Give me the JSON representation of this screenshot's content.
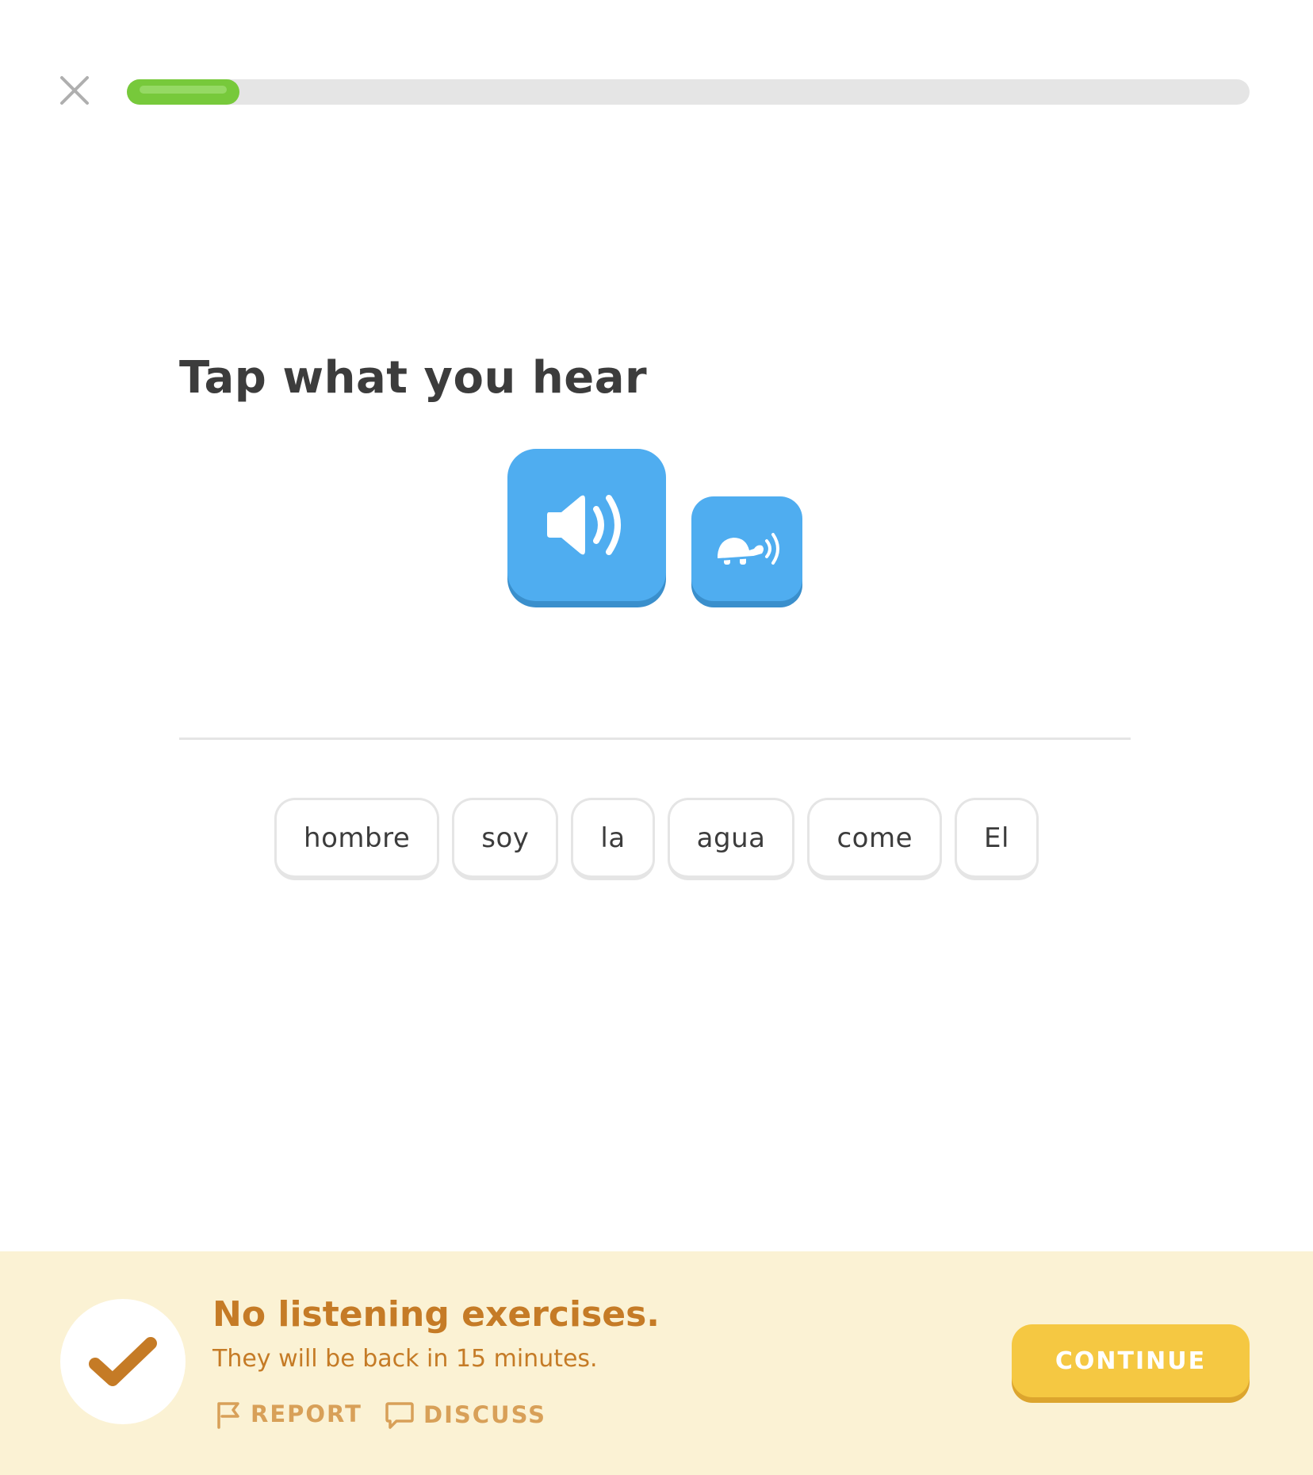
{
  "header": {
    "close_icon": "close-icon",
    "progress": 0.1
  },
  "prompt": {
    "title": "Tap what you hear"
  },
  "audio": {
    "normal_icon": "speaker-icon",
    "slow_icon": "turtle-speaker-icon"
  },
  "word_bank": {
    "words": [
      "hombre",
      "soy",
      "la",
      "agua",
      "come",
      "El"
    ]
  },
  "footer": {
    "status_icon": "checkmark-icon",
    "title": "No listening exercises.",
    "subtitle": "They will be back in 15 minutes.",
    "report_label": "REPORT",
    "report_icon": "flag-icon",
    "discuss_label": "DISCUSS",
    "discuss_icon": "speech-bubble-icon",
    "continue_label": "CONTINUE"
  },
  "colors": {
    "progress": "#77c93b",
    "audio_button": "#4fadf0",
    "footer_bg": "#fbf2d4",
    "footer_text": "#c57b26",
    "continue_button": "#f5c842"
  }
}
